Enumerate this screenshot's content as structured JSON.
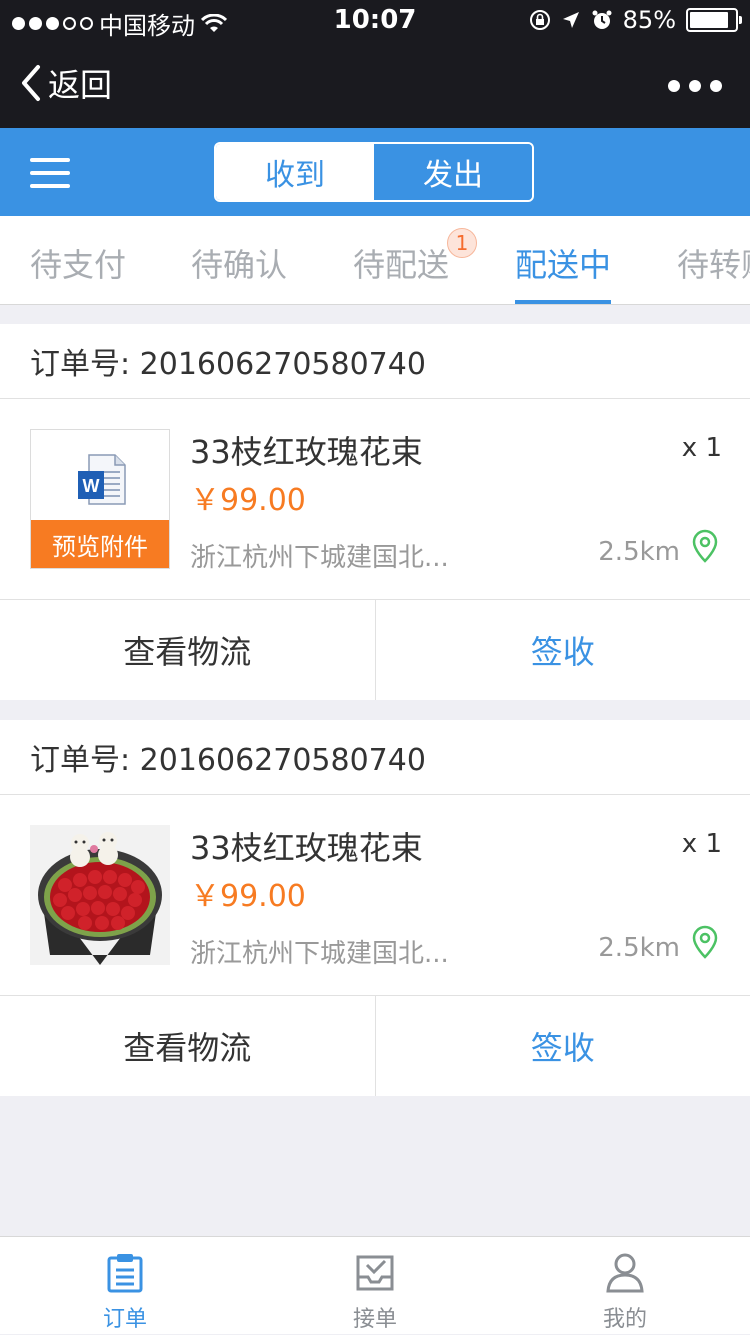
{
  "status_bar": {
    "carrier": "中国移动",
    "time": "10:07",
    "battery": "85%"
  },
  "nav": {
    "back_label": "返回"
  },
  "segment": {
    "options": [
      "收到",
      "发出"
    ],
    "selected": "收到"
  },
  "tabs": [
    {
      "label": "待支付"
    },
    {
      "label": "待确认"
    },
    {
      "label": "待配送",
      "badge": "1"
    },
    {
      "label": "配送中",
      "active": true
    },
    {
      "label": "待转账"
    }
  ],
  "orders": [
    {
      "order_label": "订单号: 201606270580740",
      "product_title": "33枝红玫瑰花束",
      "qty": "x 1",
      "price": "￥99.00",
      "address": "浙江杭州下城建国北...",
      "distance": "2.5km",
      "thumb_type": "document",
      "preview_label": "预览附件",
      "action_logistics": "查看物流",
      "action_sign": "签收"
    },
    {
      "order_label": "订单号: 201606270580740",
      "product_title": "33枝红玫瑰花束",
      "qty": "x 1",
      "price": "￥99.00",
      "address": "浙江杭州下城建国北...",
      "distance": "2.5km",
      "thumb_type": "photo",
      "action_logistics": "查看物流",
      "action_sign": "签收"
    }
  ],
  "tabbar": [
    {
      "label": "订单",
      "icon": "clipboard-icon",
      "active": true
    },
    {
      "label": "接单",
      "icon": "inbox-check-icon"
    },
    {
      "label": "我的",
      "icon": "person-icon"
    }
  ],
  "colors": {
    "accent": "#3a92e3",
    "price": "#f77b22",
    "dark_bar": "#1a1a1f"
  }
}
